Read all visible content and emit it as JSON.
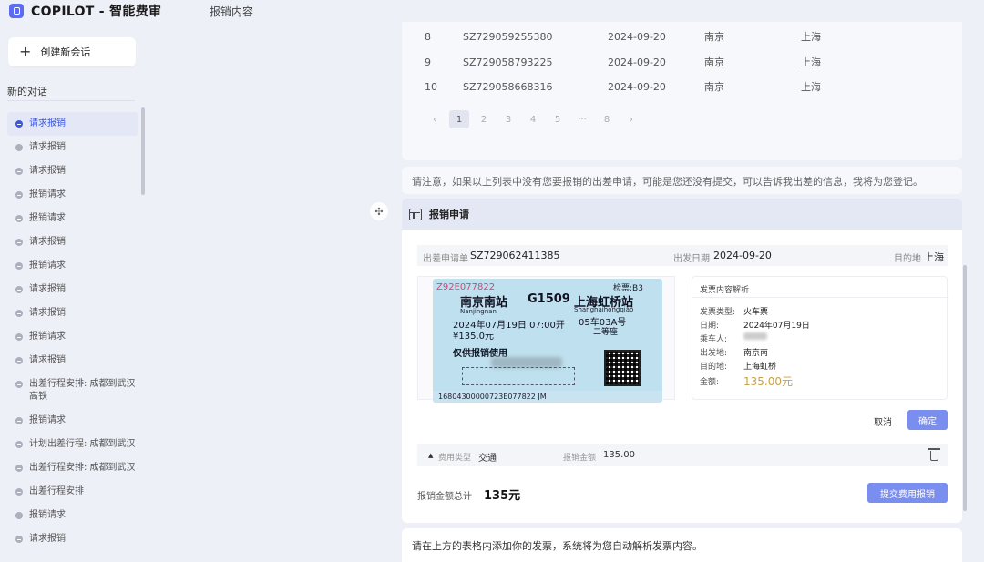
{
  "header": {
    "app_title": "COPILOT  - 智能费审",
    "page_title": "报销内容",
    "logo_icon": "copilot-logo-icon"
  },
  "sidebar": {
    "new_chat_label": "创建新会话",
    "section_title": "新的对话",
    "conversations": [
      {
        "label": "请求报销",
        "active": true
      },
      {
        "label": "请求报销"
      },
      {
        "label": "请求报销"
      },
      {
        "label": "报销请求"
      },
      {
        "label": "报销请求"
      },
      {
        "label": "请求报销"
      },
      {
        "label": "报销请求"
      },
      {
        "label": "请求报销"
      },
      {
        "label": "请求报销"
      },
      {
        "label": "报销请求"
      },
      {
        "label": "请求报销"
      },
      {
        "label": "出差行程安排: 成都到武汉高铁"
      },
      {
        "label": "报销请求"
      },
      {
        "label": "计划出差行程: 成都到武汉"
      },
      {
        "label": "出差行程安排: 成都到武汉"
      },
      {
        "label": "出差行程安排"
      },
      {
        "label": "报销请求"
      },
      {
        "label": "请求报销"
      }
    ]
  },
  "trip_table": {
    "rows": [
      {
        "index": "8",
        "code": "SZ729059255380",
        "date": "2024-09-20",
        "from": "南京",
        "to": "上海"
      },
      {
        "index": "9",
        "code": "SZ729058793225",
        "date": "2024-09-20",
        "from": "南京",
        "to": "上海"
      },
      {
        "index": "10",
        "code": "SZ729058668316",
        "date": "2024-09-20",
        "from": "南京",
        "to": "上海"
      }
    ],
    "pagination": [
      "‹",
      "1",
      "2",
      "3",
      "4",
      "5",
      "···",
      "8",
      "›"
    ],
    "current_page": "1"
  },
  "notice": "请注意，如果以上列表中没有您要报销的出差申请，可能是您还没有提交，可以告诉我出差的信息，我将为您登记。",
  "form": {
    "title": "报销申请",
    "trip_no_label": "出差申请单",
    "trip_no": "SZ729062411385",
    "depart_date_label": "出发日期",
    "depart_date": "2024-09-20",
    "destination_label": "目的地",
    "destination": "上海",
    "ticket": {
      "serial": "Z92E077822",
      "seat": "检票:B3",
      "from": "南京南站",
      "train": "G1509",
      "to": "上海虹桥站",
      "from_py": "Nanjingnan",
      "to_py": "Shanghaihongqiao",
      "time": "2024年07月19日 07:00开",
      "car": "05车03A号",
      "price": "¥135.0元",
      "class": "二等座",
      "notice": "仅供报销使用",
      "code": "16804300000723E077822 JM"
    },
    "parse": {
      "title": "发票内容解析",
      "type_label": "发票类型:",
      "type": "火车票",
      "date_label": "日期:",
      "date": "2024年07月19日",
      "passenger_label": "乘车人:",
      "from_label": "出发地:",
      "from": "南京南",
      "to_label": "目的地:",
      "to": "上海虹桥",
      "amount_label": "金额:",
      "amount": "135.00元"
    },
    "cancel_label": "取消",
    "confirm_label": "确定",
    "fee_type_label": "费用类型",
    "fee_type": "交通",
    "fee_amount_label": "报销金额",
    "fee_amount": "135.00",
    "total_label": "报销金额总计",
    "total": "135元",
    "submit_label": "提交费用报销"
  },
  "bottom_note": "请在上方的表格内添加你的发票，系统将为您自动解析发票内容。"
}
